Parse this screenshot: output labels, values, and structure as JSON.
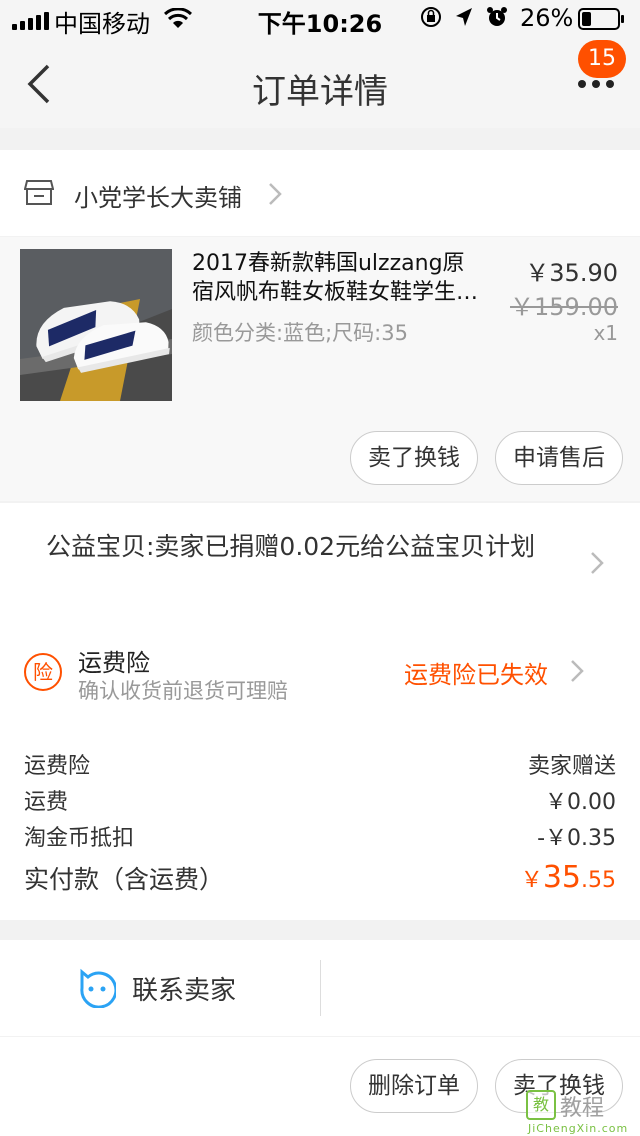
{
  "status_bar": {
    "carrier": "中国移动",
    "time": "下午10:26",
    "battery": "26%",
    "icons": [
      "signal-icon",
      "wifi-icon",
      "rotation-lock-icon",
      "location-icon",
      "alarm-icon",
      "battery-icon"
    ]
  },
  "nav": {
    "title": "订单详情",
    "badge": "15",
    "icons": [
      "back-icon",
      "more-icon"
    ]
  },
  "shop": {
    "name": "小党学长大卖铺"
  },
  "item": {
    "title_line1": "2017春新款韩国ulzzang原",
    "title_line2": "宿风帆布鞋女板鞋女鞋学生小白鞋",
    "sku": "颜色分类:蓝色;尺码:35",
    "price": "￥35.90",
    "original_price": "￥159.00",
    "quantity": "x1",
    "buttons": [
      "卖了换钱",
      "申请售后"
    ]
  },
  "charity": {
    "text": "公益宝贝:卖家已捐赠0.02元给公益宝贝计划"
  },
  "insurance": {
    "title": "运费险",
    "subtitle": "确认收货前退货可理赔",
    "status": "运费险已失效"
  },
  "fees": [
    {
      "label": "运费险",
      "value": "卖家赠送"
    },
    {
      "label": "运费",
      "value": "￥0.00"
    },
    {
      "label": "淘金币抵扣",
      "value": "-￥0.35"
    }
  ],
  "total": {
    "label": "实付款（含运费）",
    "currency": "￥",
    "integer": "35",
    "decimal": ".55"
  },
  "contact": {
    "label": "联系卖家"
  },
  "actions": {
    "buttons": [
      "删除订单",
      "卖了换钱"
    ]
  },
  "watermark": {
    "word": "教程",
    "url": "JiChengXin.com"
  },
  "colors": {
    "accent": "#ff5000",
    "background": "#f2f2f2"
  }
}
